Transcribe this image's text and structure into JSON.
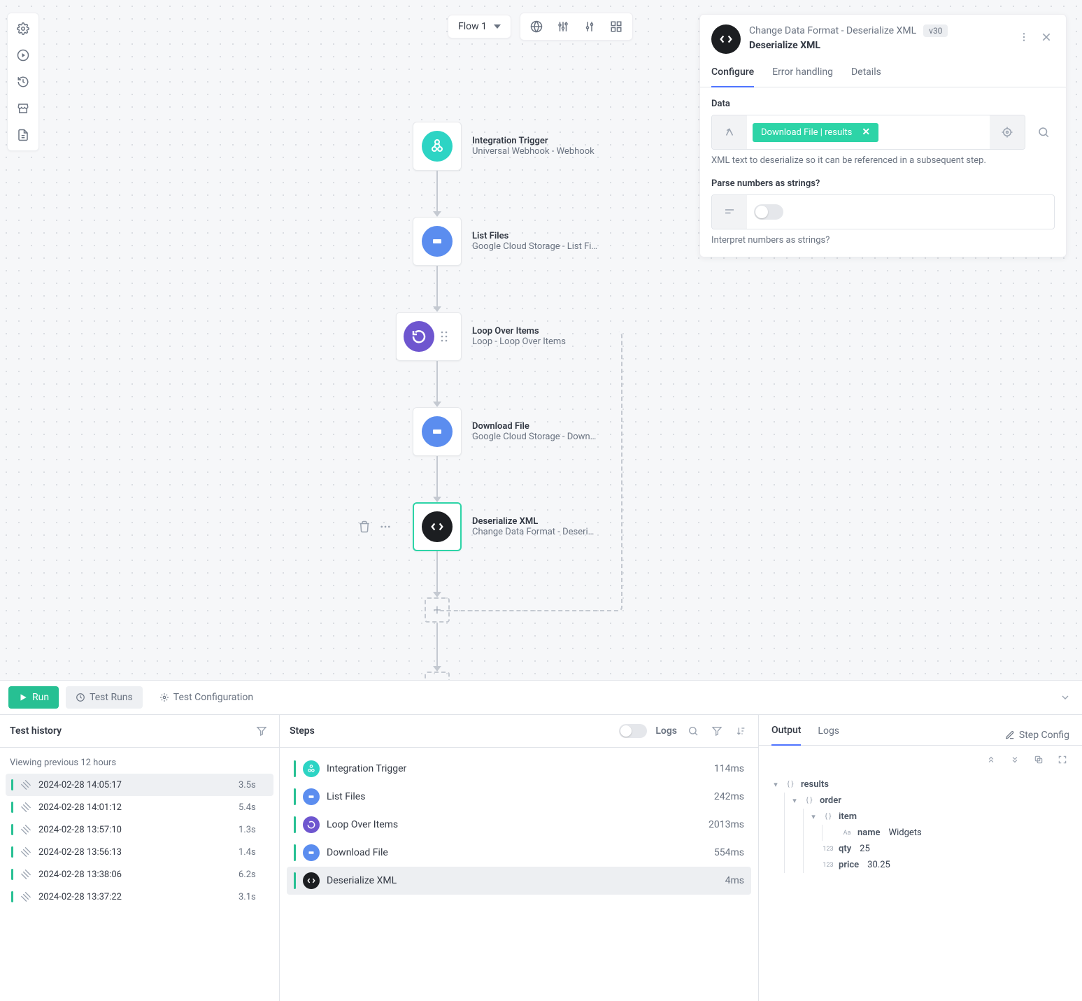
{
  "top": {
    "flow_label": "Flow 1"
  },
  "panel": {
    "title": "Change Data Format - Deserialize XML",
    "version": "v30",
    "subtitle": "Deserialize XML",
    "tabs": {
      "configure": "Configure",
      "error": "Error handling",
      "details": "Details"
    },
    "data_label": "Data",
    "data_pill": "Download File | results",
    "data_help": "XML text to deserialize so it can be referenced in a subsequent step.",
    "parse_label": "Parse numbers as strings?",
    "parse_help": "Interpret numbers as strings?"
  },
  "nodes": {
    "trigger": {
      "t1": "Integration Trigger",
      "t2": "Universal Webhook - Webhook"
    },
    "list": {
      "t1": "List Files",
      "t2": "Google Cloud Storage - List Fi…"
    },
    "loop": {
      "t1": "Loop Over Items",
      "t2": "Loop - Loop Over Items"
    },
    "download": {
      "t1": "Download File",
      "t2": "Google Cloud Storage - Down…"
    },
    "deser": {
      "t1": "Deserialize XML",
      "t2": "Change Data Format - Deseri…"
    }
  },
  "bottom": {
    "run": "Run",
    "test_runs": "Test Runs",
    "test_config": "Test Configuration"
  },
  "history": {
    "title": "Test history",
    "sub": "Viewing previous 12 hours",
    "rows": [
      {
        "ts": "2024-02-28 14:05:17",
        "dur": "3.5s"
      },
      {
        "ts": "2024-02-28 14:01:12",
        "dur": "5.4s"
      },
      {
        "ts": "2024-02-28 13:57:10",
        "dur": "1.3s"
      },
      {
        "ts": "2024-02-28 13:56:13",
        "dur": "1.4s"
      },
      {
        "ts": "2024-02-28 13:38:06",
        "dur": "6.2s"
      },
      {
        "ts": "2024-02-28 13:37:22",
        "dur": "3.1s"
      }
    ]
  },
  "steps": {
    "title": "Steps",
    "logs_label": "Logs",
    "rows": [
      {
        "name": "Integration Trigger",
        "time": "114ms",
        "color": "teal"
      },
      {
        "name": "List Files",
        "time": "242ms",
        "color": "blue"
      },
      {
        "name": "Loop Over Items",
        "time": "2013ms",
        "color": "purple"
      },
      {
        "name": "Download File",
        "time": "554ms",
        "color": "blue"
      },
      {
        "name": "Deserialize XML",
        "time": "4ms",
        "color": "black"
      }
    ]
  },
  "output": {
    "tabs": {
      "output": "Output",
      "logs": "Logs"
    },
    "step_config": "Step Config",
    "tree": {
      "results": "results",
      "order": "order",
      "item": "item",
      "name_k": "name",
      "name_v": "Widgets",
      "qty_k": "qty",
      "qty_v": "25",
      "price_k": "price",
      "price_v": "30.25"
    }
  }
}
